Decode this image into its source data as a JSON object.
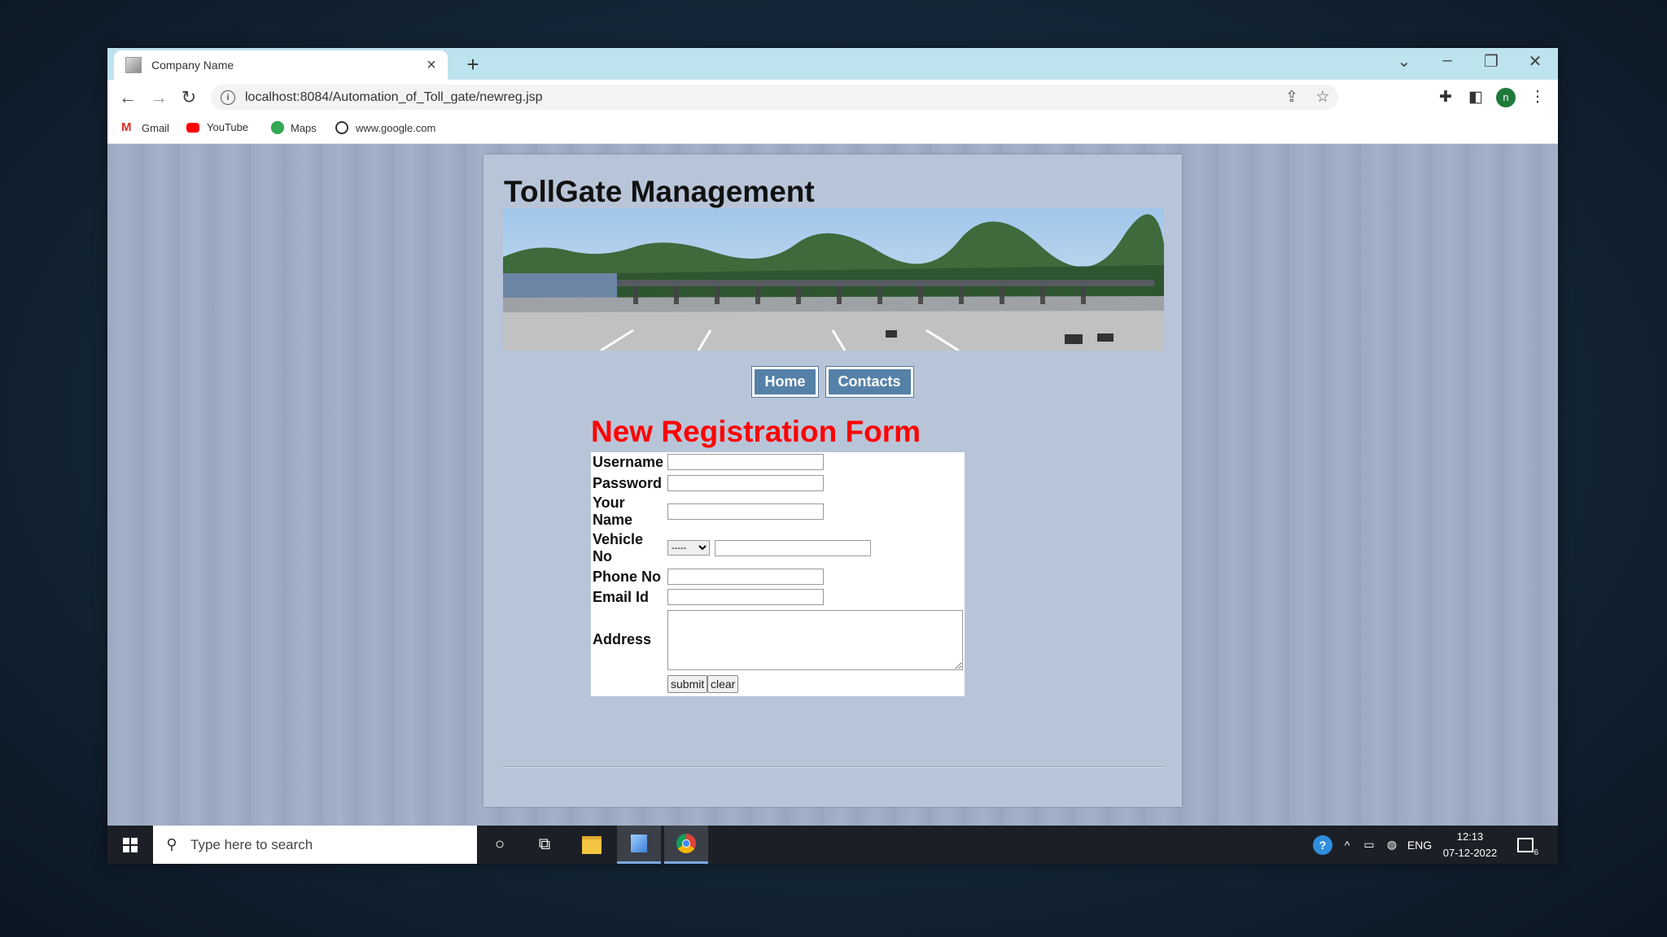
{
  "browser": {
    "tab_title": "Company Name",
    "new_tab": "+",
    "url": "localhost:8084/Automation_of_Toll_gate/newreg.jsp",
    "bookmarks": [
      {
        "label": "Gmail"
      },
      {
        "label": "YouTube"
      },
      {
        "label": "Maps"
      },
      {
        "label": "www.google.com"
      }
    ],
    "profile_initial": "n"
  },
  "site": {
    "title": "TollGate Management",
    "nav": {
      "home": "Home",
      "contacts": "Contacts"
    }
  },
  "form": {
    "title": "New Registration Form",
    "labels": {
      "username": "Username",
      "password": "Password",
      "your_name": "Your Name",
      "vehicle_no": "Vehicle No",
      "phone_no": "Phone No",
      "email_id": "Email Id",
      "address": "Address"
    },
    "vehicle_select_value": "-----",
    "buttons": {
      "submit": "submit",
      "clear": "clear"
    }
  },
  "taskbar": {
    "search_placeholder": "Type here to search",
    "language": "ENG",
    "time": "12:13",
    "date": "07-12-2022",
    "notification_count": "6"
  }
}
